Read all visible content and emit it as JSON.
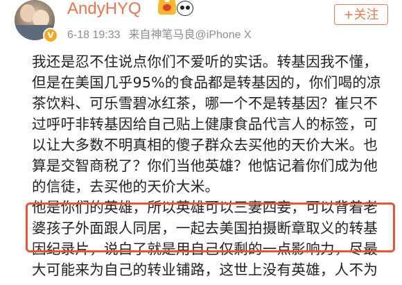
{
  "post": {
    "username": "AndyHYQ",
    "follow_label": "+关注",
    "timestamp": "6-18 19:33",
    "source": "来自神笔马良@iPhone X",
    "verified_mark": "V",
    "lines": [
      "我还是忍不住说点你们不爱听的实话。转基因我不懂，",
      "但是在美国几乎95%的食品都是转基因的，你们喝的凉",
      "茶饮料、可乐雪碧冰红茶，哪一个不是转基因？崔只不",
      "过呼吁非转基因给自己贴上健康食品代言人的标签，可",
      "以让大多数不明真相的傻子群众去买他的天价大米。也",
      "算是交智商税了？你们当他英雄？他惦记着你们成为他",
      "的信徒，去买他的天价大米。",
      "他是你们的英雄，所以英雄可以三妻四妾，可以背着老",
      "婆孩子外面跟人同居，一起去美国拍摄断章取义的转基",
      "因纪录片，说白了就是用自己仅剩的一点影响力，尽最",
      "大可能来为自己的转业铺路，这世上没有英雄，人不为"
    ]
  }
}
